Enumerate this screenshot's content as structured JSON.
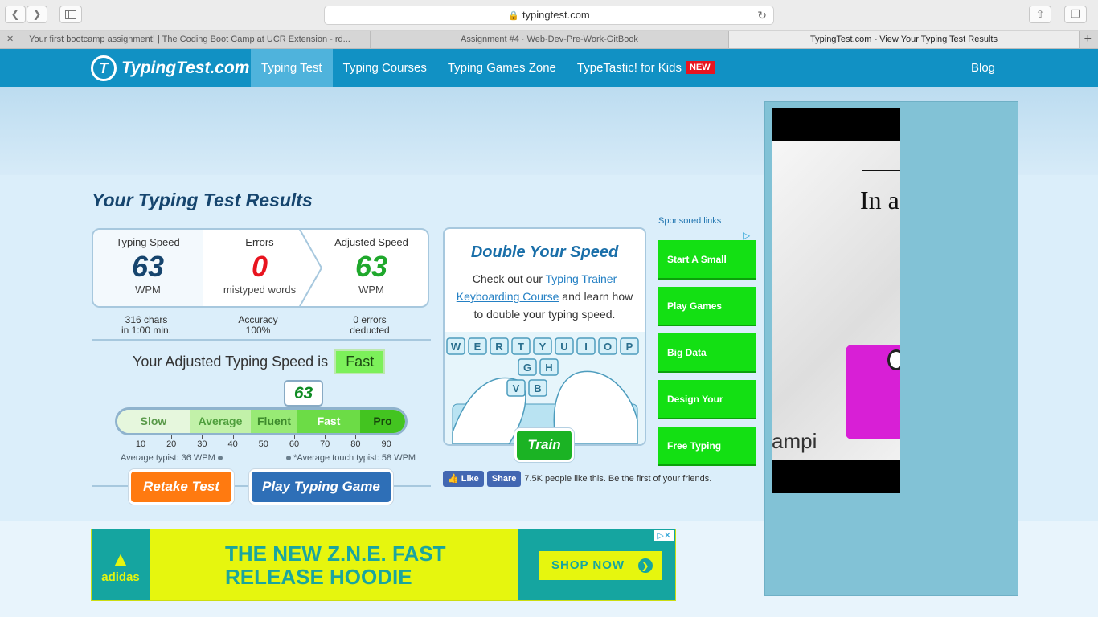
{
  "browser": {
    "url": "typingtest.com",
    "tabs": [
      {
        "label": "Your first bootcamp assignment! | The Coding Boot Camp at UCR Extension - rd..."
      },
      {
        "label": "Assignment #4 · Web-Dev-Pre-Work-GitBook"
      },
      {
        "label": "TypingTest.com - View Your Typing Test Results"
      }
    ]
  },
  "header": {
    "logo_text": "TypingTest.com",
    "menu": [
      "Typing Test",
      "Typing Courses",
      "Typing Games Zone",
      "TypeTastic! for Kids"
    ],
    "new_badge": "NEW",
    "blog": "Blog"
  },
  "results": {
    "title": "Your Typing Test Results",
    "speed_label": "Typing Speed",
    "speed_value": "63",
    "speed_unit": "WPM",
    "errors_label": "Errors",
    "errors_value": "0",
    "errors_unit": "mistyped words",
    "adjusted_label": "Adjusted Speed",
    "adjusted_value": "63",
    "adjusted_unit": "WPM",
    "chars_line1": "316 chars",
    "chars_line2": "in 1:00 min.",
    "accuracy_line1": "Accuracy",
    "accuracy_line2": "100%",
    "errors_line1": "0 errors",
    "errors_line2": "deducted",
    "adjusted_sentence": "Your Adjusted Typing Speed is",
    "rating": "Fast",
    "meter_value": "63",
    "meter_segments": [
      {
        "label": "Slow",
        "color": "#e6f7dd",
        "text": "#5a9a4a"
      },
      {
        "label": "Average",
        "color": "#c2f1a9",
        "text": "#4f9f3d"
      },
      {
        "label": "Fluent",
        "color": "#98ea75",
        "text": "#3d8a2c"
      },
      {
        "label": "Fast",
        "color": "#6cdc46",
        "text": "#ffffff"
      },
      {
        "label": "Pro",
        "color": "#43c420",
        "text": "#17460c"
      }
    ],
    "ticks": [
      "10",
      "20",
      "30",
      "40",
      "50",
      "60",
      "70",
      "80",
      "90"
    ],
    "avg_typist": "Average typist: 36 WPM",
    "avg_touch_typist": "*Average touch typist: 58 WPM",
    "retake_label": "Retake Test",
    "play_label": "Play Typing Game"
  },
  "double": {
    "title": "Double Your Speed",
    "text_before": "Check out our ",
    "link_text": "Typing Trainer Keyboarding Course",
    "text_after": " and learn how to double your typing speed.",
    "keys_row1": [
      "W",
      "E",
      "R",
      "T",
      "Y",
      "U",
      "I",
      "O",
      "P"
    ],
    "keys_row2": [
      "G",
      "H"
    ],
    "keys_row3": [
      "V",
      "B"
    ],
    "train_label": "Train"
  },
  "facebook": {
    "like": "Like",
    "share": "Share",
    "text": "7.5K people like this. Be the first of your friends."
  },
  "sponsored": {
    "label": "Sponsored links",
    "items": [
      "Start A Small",
      "Play Games",
      "Big Data",
      "Design Your",
      "Free Typing"
    ]
  },
  "side_ad": {
    "headline": "In a",
    "word": "ampi"
  },
  "bottom_ad": {
    "brand": "adidas",
    "headline_line1": "THE NEW Z.N.E. FAST",
    "headline_line2": "RELEASE HOODIE",
    "cta": "SHOP NOW"
  }
}
